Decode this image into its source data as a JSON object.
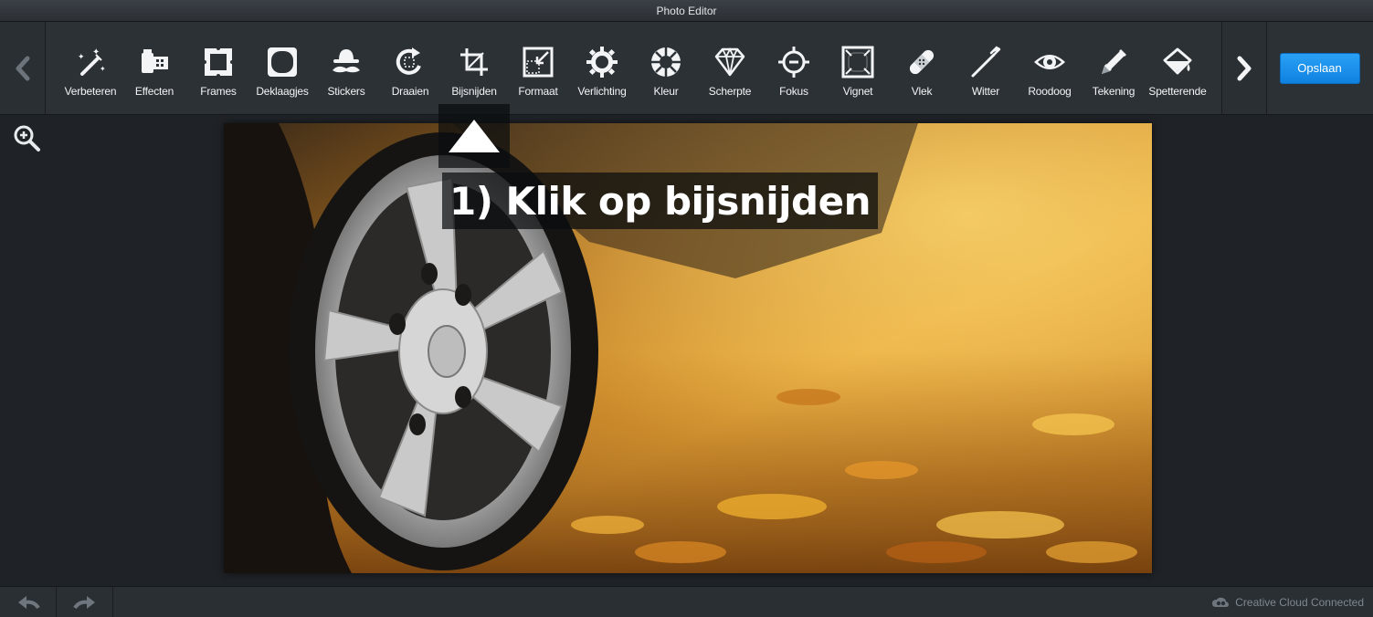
{
  "window": {
    "title": "Photo Editor"
  },
  "toolbar": {
    "tools": [
      {
        "label": "Verbeteren",
        "icon": "magic-wand-icon"
      },
      {
        "label": "Effecten",
        "icon": "film-effects-icon"
      },
      {
        "label": "Frames",
        "icon": "frame-icon"
      },
      {
        "label": "Deklaagjes",
        "icon": "overlay-icon"
      },
      {
        "label": "Stickers",
        "icon": "mustache-hat-icon"
      },
      {
        "label": "Draaien",
        "icon": "rotate-icon"
      },
      {
        "label": "Bijsnijden",
        "icon": "crop-icon"
      },
      {
        "label": "Formaat",
        "icon": "resize-icon"
      },
      {
        "label": "Verlichting",
        "icon": "sun-icon"
      },
      {
        "label": "Kleur",
        "icon": "color-wheel-icon"
      },
      {
        "label": "Scherpte",
        "icon": "diamond-icon"
      },
      {
        "label": "Fokus",
        "icon": "focus-target-icon"
      },
      {
        "label": "Vignet",
        "icon": "vignette-icon"
      },
      {
        "label": "Vlek",
        "icon": "bandage-icon"
      },
      {
        "label": "Witter",
        "icon": "toothbrush-icon"
      },
      {
        "label": "Roodoog",
        "icon": "eye-icon"
      },
      {
        "label": "Tekening",
        "icon": "pencil-icon"
      },
      {
        "label": "Spetterende",
        "icon": "paint-bucket-icon"
      }
    ],
    "save_label": "Opslaan"
  },
  "tutorial": {
    "step_text": "1) Klik op bijsnijden"
  },
  "status": {
    "cloud_label": "Creative Cloud Connected"
  },
  "colors": {
    "accent": "#1a8fea",
    "background": "#1f2327",
    "toolbar": "#2c3136"
  }
}
